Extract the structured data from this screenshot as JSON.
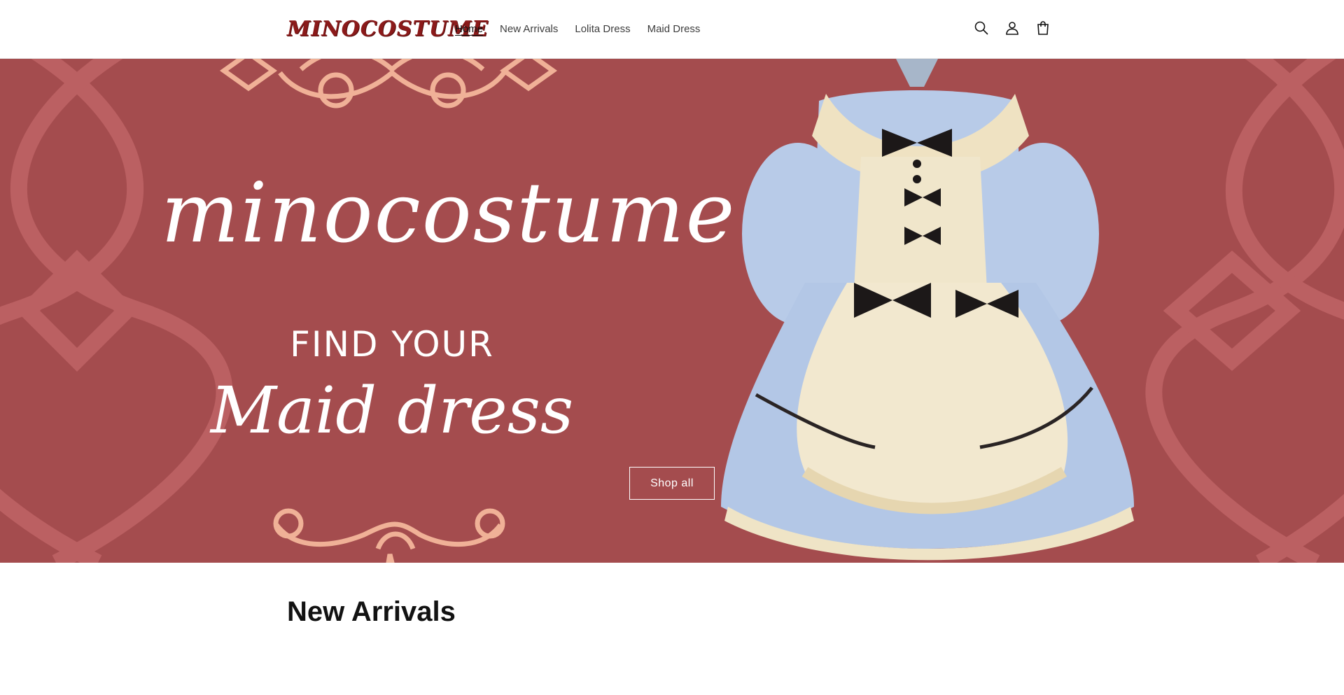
{
  "header": {
    "logo_text": "MINOCOSTUME",
    "nav": [
      {
        "label": "Home",
        "active": true
      },
      {
        "label": "New Arrivals",
        "active": false
      },
      {
        "label": "Lolita Dress",
        "active": false
      },
      {
        "label": "Maid Dress",
        "active": false
      }
    ],
    "icons": [
      "search-icon",
      "account-icon",
      "cart-icon"
    ]
  },
  "hero": {
    "script_title": "minocostume",
    "tagline": "FIND YOUR",
    "subtitle": "Maid dress",
    "cta_label": "Shop all",
    "colors": {
      "background": "#a44c4e",
      "ornament": "#f0b197",
      "pattern": "#c06466",
      "text": "#ffffff"
    }
  },
  "section": {
    "title": "New Arrivals"
  }
}
